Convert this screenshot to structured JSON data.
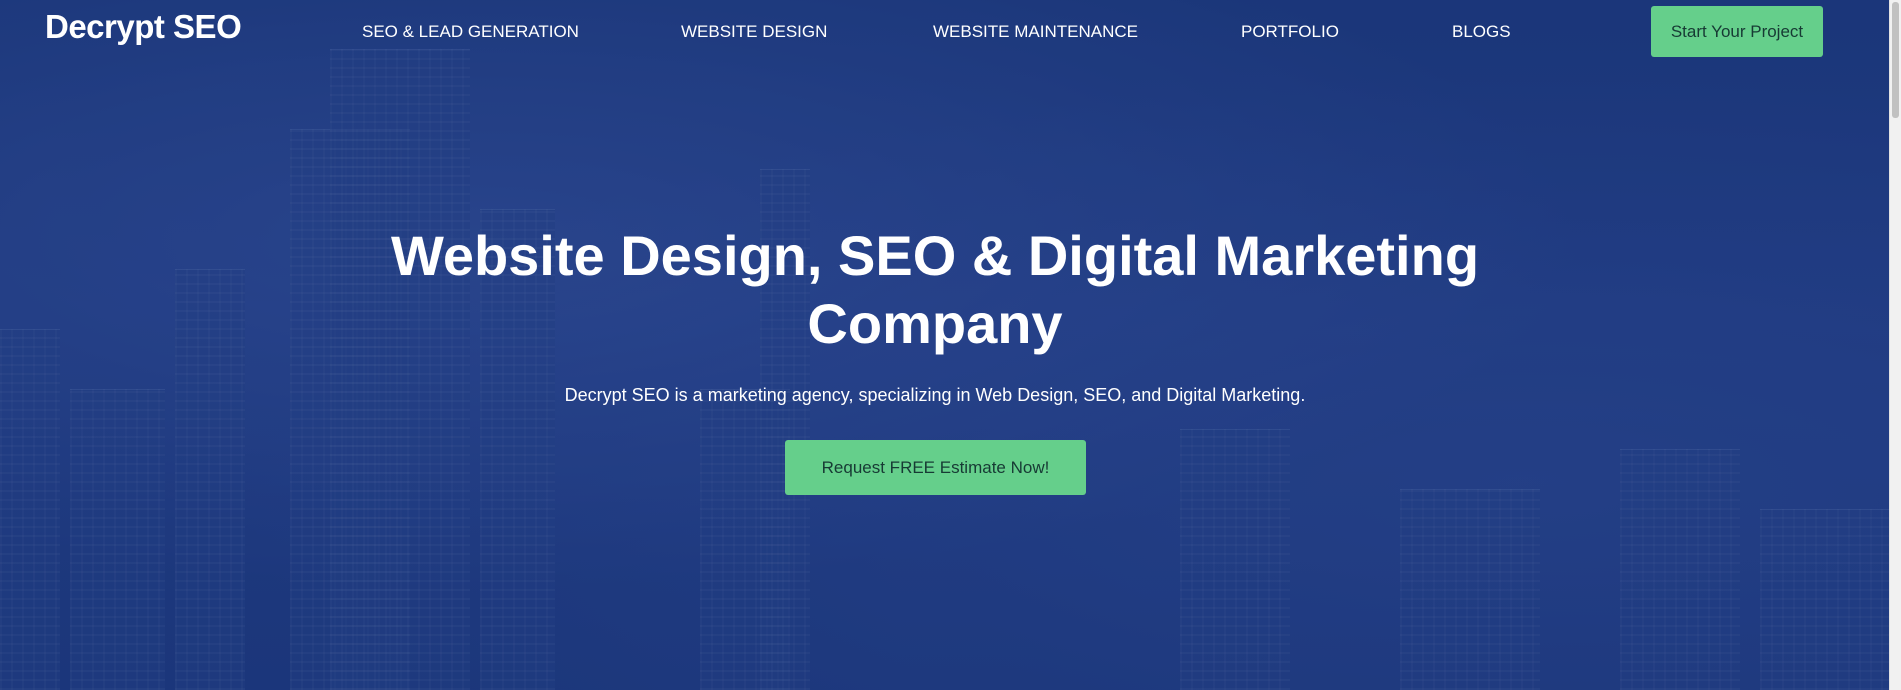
{
  "header": {
    "logo": "Decrypt SEO",
    "nav": [
      {
        "label": "SEO & LEAD GENERATION"
      },
      {
        "label": "WEBSITE DESIGN"
      },
      {
        "label": "WEBSITE MAINTENANCE"
      },
      {
        "label": "PORTFOLIO"
      },
      {
        "label": "BLOGS"
      }
    ],
    "cta_label": "Start Your Project"
  },
  "hero": {
    "title_line1": "Website Design, SEO & Digital Marketing",
    "title_line2": "Company",
    "subtitle": "Decrypt SEO is a marketing agency, specializing in Web Design, SEO, and Digital Marketing.",
    "cta_label": "Request FREE Estimate Now!"
  },
  "colors": {
    "background": "#1f3c80",
    "accent_button": "#65cf8b",
    "button_text": "#173a34",
    "text": "#ffffff"
  }
}
